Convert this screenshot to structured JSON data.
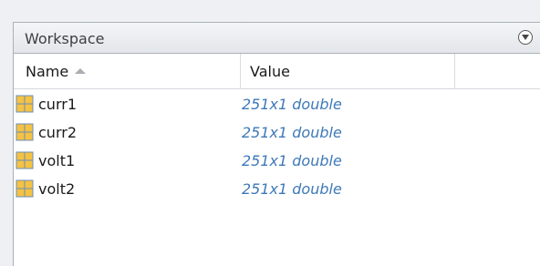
{
  "panel": {
    "title": "Workspace",
    "menu_icon": "circle-down-arrow-icon"
  },
  "columns": {
    "name": "Name",
    "value": "Value",
    "sort_icon": "sort-ascending-icon"
  },
  "variables": [
    {
      "name": "curr1",
      "value": "251x1 double",
      "icon": "matrix-variable-icon"
    },
    {
      "name": "curr2",
      "value": "251x1 double",
      "icon": "matrix-variable-icon"
    },
    {
      "name": "volt1",
      "value": "251x1 double",
      "icon": "matrix-variable-icon"
    },
    {
      "name": "volt2",
      "value": "251x1 double",
      "icon": "matrix-variable-icon"
    }
  ],
  "colors": {
    "value_text": "#3e79b8",
    "icon_fill": "#f5c242",
    "icon_border": "#6b8fb8"
  }
}
